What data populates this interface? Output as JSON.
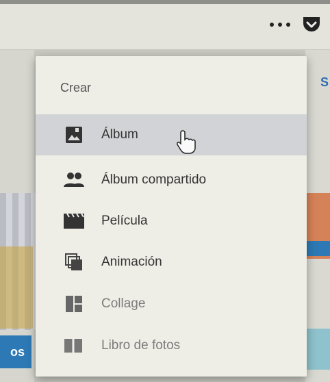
{
  "menu": {
    "title": "Crear",
    "items": [
      {
        "label": "Álbum",
        "icon": "photo-album-icon",
        "selected": true
      },
      {
        "label": "Álbum compartido",
        "icon": "people-icon"
      },
      {
        "label": "Película",
        "icon": "movie-clapper-icon"
      },
      {
        "label": "Animación",
        "icon": "animation-stack-icon"
      },
      {
        "label": "Collage",
        "icon": "collage-icon"
      },
      {
        "label": "Libro de fotos",
        "icon": "photo-book-icon"
      }
    ]
  },
  "background": {
    "left_label": "os",
    "right_label": "S"
  },
  "colors": {
    "menu_bg": "#eeeee6",
    "selected_bg": "#d1d3d6",
    "icon_color": "#333333",
    "accent_blue": "#2c79b5"
  }
}
